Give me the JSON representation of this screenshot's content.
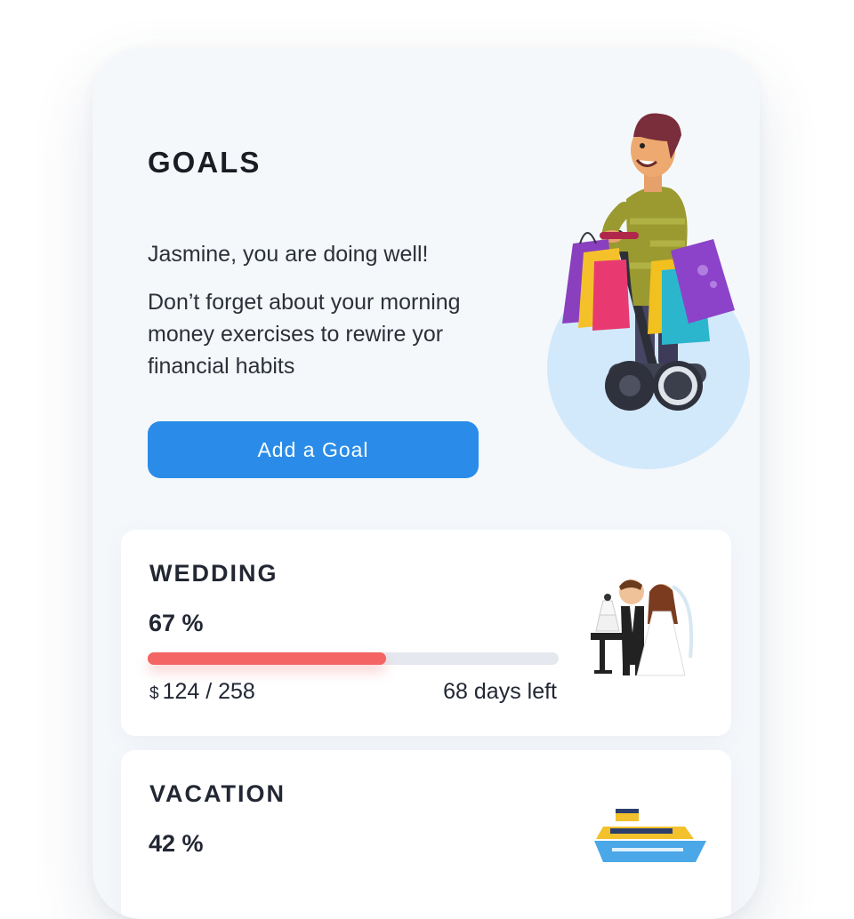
{
  "header": {
    "title": "GOALS",
    "greeting": "Jasmine, you are doing well!",
    "message": "Don’t forget about your morning money exercises to rewire yor financial habits",
    "add_goal_label": "Add a Goal"
  },
  "colors": {
    "accent": "#2a8ce8",
    "progress": "#f46464",
    "background": "#f5f8fb",
    "track": "#e6e8ef"
  },
  "goals": [
    {
      "name": "WEDDING",
      "percent_label": "67 %",
      "progress": 0.58,
      "currency": "$",
      "amount": "124 / 258",
      "days_left": "68 days left",
      "icon": "wedding-couple-icon"
    },
    {
      "name": "VACATION",
      "percent_label": "42 %",
      "icon": "cruise-ship-icon"
    }
  ]
}
